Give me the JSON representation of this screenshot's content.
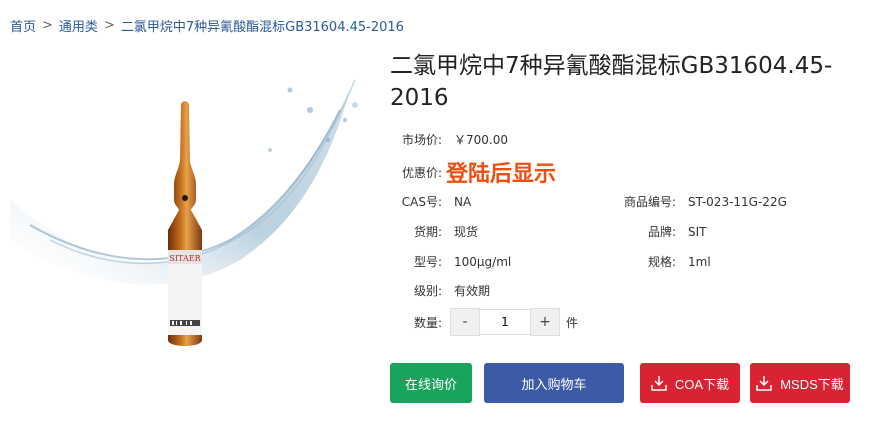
{
  "breadcrumb": {
    "home": "首页",
    "sep1": ">",
    "category": "通用类",
    "sep2": ">",
    "current": "二氯甲烷中7种异氰酸酯混标GB31604.45-2016"
  },
  "product": {
    "title": "二氯甲烷中7种异氰酸酯混标GB31604.45-2016",
    "market_price_label": "市场价:",
    "market_price": "￥700.00",
    "discount_label": "优惠价:",
    "discount_value": "登陆后显示",
    "cas_label": "CAS号:",
    "cas_value": "NA",
    "code_label": "商品编号:",
    "code_value": "ST-023-11G-22G",
    "stock_label": "货期:",
    "stock_value": "现货",
    "brand_label": "品牌:",
    "brand_value": "SIT",
    "model_label": "型号:",
    "model_value": "100μg/ml",
    "spec_label": "规格:",
    "spec_value": "1ml",
    "grade_label": "级别:",
    "grade_value": "有效期",
    "qty_label": "数量:",
    "qty_minus": "-",
    "qty_value": "1",
    "qty_plus": "+",
    "qty_unit": "件"
  },
  "image": {
    "label_text": "SITAER"
  },
  "actions": {
    "inquiry": "在线询价",
    "cart": "加入购物车",
    "coa": "COA下载",
    "msds": "MSDS下载"
  },
  "colors": {
    "link": "#2b5a9b",
    "discount": "#f04d0f",
    "inquiry_btn": "#1aa35b",
    "cart_btn": "#3c5aa6",
    "download_btn": "#d92332"
  }
}
